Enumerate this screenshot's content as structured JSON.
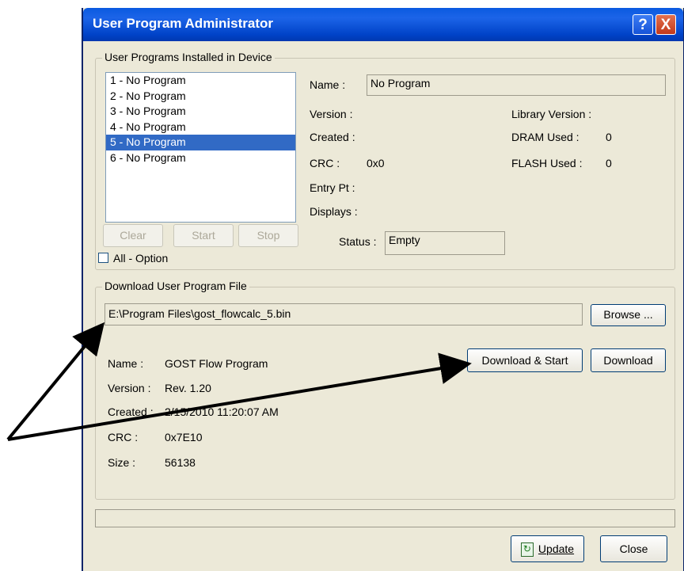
{
  "window": {
    "title": "User Program Administrator",
    "help_glyph": "?",
    "close_glyph": "X"
  },
  "installed": {
    "group_label": "User Programs Installed in Device",
    "programs": [
      "1 - No Program",
      "2 - No Program",
      "3 - No Program",
      "4 - No Program",
      "5 - No Program",
      "6 - No Program"
    ],
    "selected_index": 4,
    "name_label": "Name :",
    "name_value": "No Program",
    "version_label": "Version :",
    "created_label": "Created :",
    "crc_label": "CRC :",
    "crc_value": "0x0",
    "entry_label": "Entry Pt :",
    "displays_label": "Displays :",
    "library_label": "Library Version :",
    "dram_label": "DRAM Used :",
    "dram_value": "0",
    "flash_label": "FLASH Used :",
    "flash_value": "0",
    "status_label": "Status :",
    "status_value": "Empty",
    "clear_button": "Clear",
    "start_button": "Start",
    "stop_button": "Stop",
    "all_option_label": "All - Option"
  },
  "download": {
    "group_label": "Download User Program File",
    "path_value": "E:\\Program Files\\gost_flowcalc_5.bin",
    "browse_button": "Browse ...",
    "download_start_button": "Download & Start",
    "download_button": "Download",
    "name_label": "Name :",
    "name_value": "GOST Flow Program",
    "version_label": "Version :",
    "version_value": "Rev. 1.20",
    "created_label": "Created :",
    "created_value": "2/15/2010 11:20:07 AM",
    "crc_label": "CRC :",
    "crc_value": "0x7E10",
    "size_label": "Size :",
    "size_value": "56138"
  },
  "footer": {
    "update_button": "Update",
    "close_button": "Close",
    "update_icon": "refresh-icon"
  },
  "colors": {
    "titlebar": "#0a5ae0",
    "selection": "#316ac5",
    "dialog_bg": "#ece9d8"
  }
}
